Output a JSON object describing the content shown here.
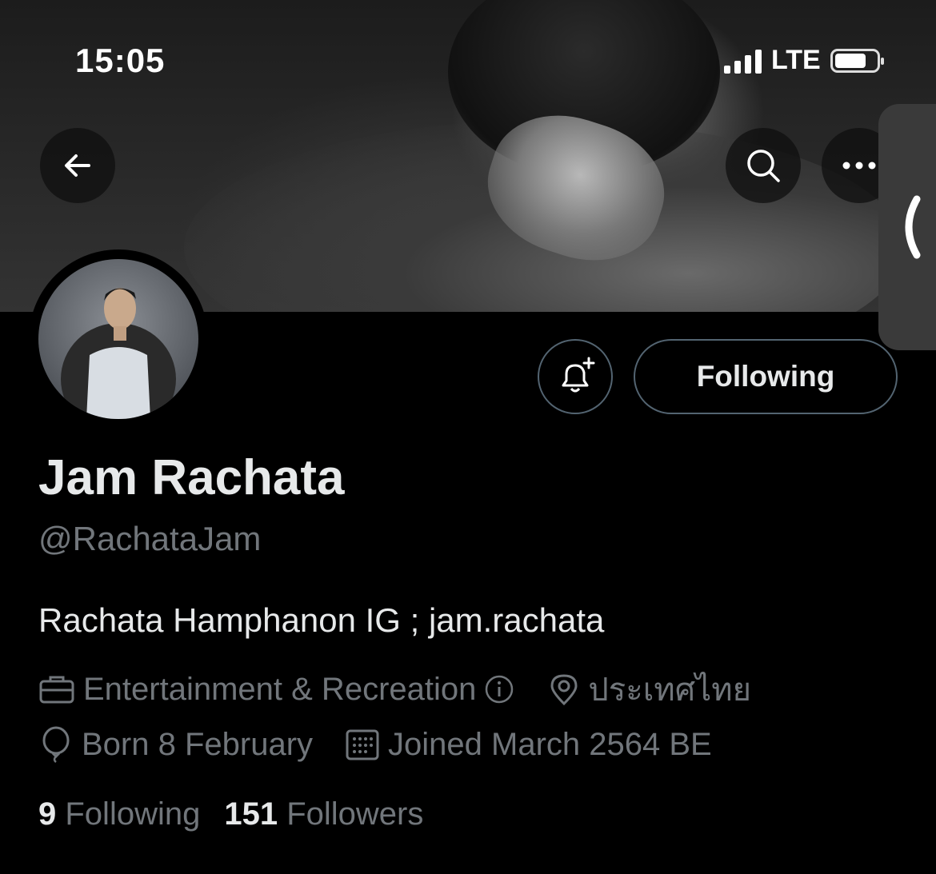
{
  "status_bar": {
    "time": "15:05",
    "network": "LTE"
  },
  "header": {
    "back_icon": "arrow-left-icon",
    "search_icon": "search-icon",
    "more_icon": "more-horizontal-icon"
  },
  "actions": {
    "notify_icon": "bell-plus-icon",
    "follow_label": "Following"
  },
  "profile": {
    "display_name": "Jam Rachata",
    "handle": "@RachataJam",
    "bio": "Rachata Hamphanon IG ; jam.rachata",
    "category": "Entertainment & Recreation",
    "location": "ประเทศไทย",
    "birthday": "Born 8 February",
    "joined": "Joined March 2564 BE"
  },
  "stats": {
    "following_count": "9",
    "following_label": "Following",
    "followers_count": "151",
    "followers_label": "Followers"
  },
  "colors": {
    "background": "#000000",
    "primary_text": "#e7e9ea",
    "secondary_text": "#71767b",
    "border": "#536471"
  }
}
